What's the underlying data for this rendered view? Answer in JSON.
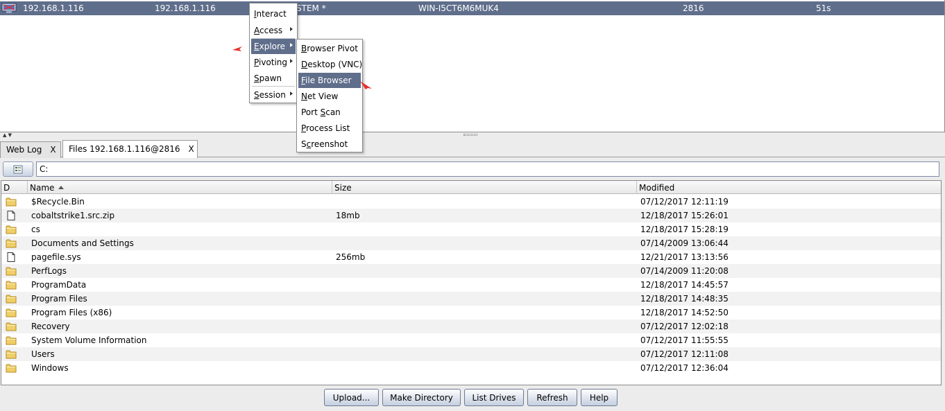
{
  "session": {
    "external_ip": "192.168.1.116",
    "internal_ip": "192.168.1.116",
    "user": "STEM *",
    "computer": "WIN-I5CT6M6MUK4",
    "pid": "2816",
    "last": "51s"
  },
  "context_menu": {
    "items": [
      {
        "mn": "I",
        "rest": "nteract"
      },
      {
        "mn": "A",
        "rest": "ccess"
      },
      {
        "mn": "E",
        "rest": "xplore"
      },
      {
        "mn": "P",
        "rest": "ivoting"
      },
      {
        "mn": "S",
        "rest": "pawn"
      },
      {
        "mn": "S",
        "rest": "ession"
      }
    ]
  },
  "explore_menu": {
    "items": [
      {
        "pre": "",
        "mn": "B",
        "rest": "rowser Pivot"
      },
      {
        "pre": "",
        "mn": "D",
        "rest": "esktop (VNC)"
      },
      {
        "pre": "",
        "mn": "F",
        "rest": "ile Browser"
      },
      {
        "pre": "",
        "mn": "N",
        "rest": "et View"
      },
      {
        "pre": "Port ",
        "mn": "S",
        "rest": "can"
      },
      {
        "pre": "",
        "mn": "P",
        "rest": "rocess List"
      },
      {
        "pre": "S",
        "mn": "c",
        "rest": "reenshot"
      }
    ]
  },
  "tabs": {
    "web_log": "Web Log",
    "files": "Files 192.168.1.116@2816",
    "close": "X"
  },
  "path": "C:",
  "table": {
    "headers": {
      "d": "D",
      "name": "Name",
      "size": "Size",
      "modified": "Modified"
    },
    "rows": [
      {
        "type": "folder",
        "name": "$Recycle.Bin",
        "size": "",
        "modified": "07/12/2017 12:11:19"
      },
      {
        "type": "file",
        "name": "cobaltstrike1.src.zip",
        "size": "18mb",
        "modified": "12/18/2017 15:26:01"
      },
      {
        "type": "folder",
        "name": "cs",
        "size": "",
        "modified": "12/18/2017 15:28:19"
      },
      {
        "type": "folder",
        "name": "Documents and Settings",
        "size": "",
        "modified": "07/14/2009 13:06:44"
      },
      {
        "type": "file",
        "name": "pagefile.sys",
        "size": "256mb",
        "modified": "12/21/2017 13:13:56"
      },
      {
        "type": "folder",
        "name": "PerfLogs",
        "size": "",
        "modified": "07/14/2009 11:20:08"
      },
      {
        "type": "folder",
        "name": "ProgramData",
        "size": "",
        "modified": "12/18/2017 14:45:57"
      },
      {
        "type": "folder",
        "name": "Program Files",
        "size": "",
        "modified": "12/18/2017 14:48:35"
      },
      {
        "type": "folder",
        "name": "Program Files (x86)",
        "size": "",
        "modified": "12/18/2017 14:52:50"
      },
      {
        "type": "folder",
        "name": "Recovery",
        "size": "",
        "modified": "07/12/2017 12:02:18"
      },
      {
        "type": "folder",
        "name": "System Volume Information",
        "size": "",
        "modified": "07/12/2017 11:55:55"
      },
      {
        "type": "folder",
        "name": "Users",
        "size": "",
        "modified": "07/12/2017 12:11:08"
      },
      {
        "type": "folder",
        "name": "Windows",
        "size": "",
        "modified": "07/12/2017 12:36:04"
      }
    ]
  },
  "buttons": {
    "upload": "Upload...",
    "make_directory": "Make Directory",
    "list_drives": "List Drives",
    "refresh": "Refresh",
    "help": "Help"
  },
  "colors": {
    "selection": "#5f6e8b",
    "annotation_arrow": "#e8302a",
    "folder": "#e9c254"
  }
}
